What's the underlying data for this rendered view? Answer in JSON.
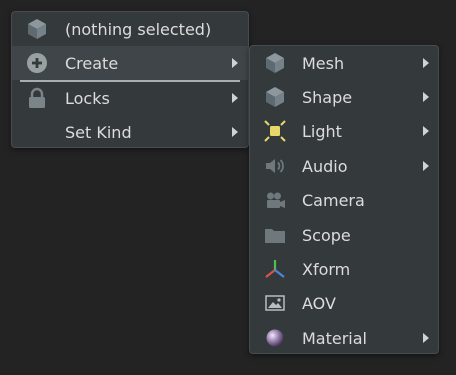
{
  "main_menu": {
    "items": [
      {
        "label": "(nothing selected)",
        "icon": "cube-icon",
        "has_submenu": false
      },
      {
        "label": "Create",
        "icon": "plus-circle-icon",
        "has_submenu": true
      },
      {
        "label": "Locks",
        "icon": "lock-icon",
        "has_submenu": true
      },
      {
        "label": "Set Kind",
        "icon": "",
        "has_submenu": true
      }
    ]
  },
  "create_submenu": {
    "items": [
      {
        "label": "Mesh",
        "icon": "mesh-cube-icon",
        "has_submenu": true
      },
      {
        "label": "Shape",
        "icon": "shape-cube-icon",
        "has_submenu": true
      },
      {
        "label": "Light",
        "icon": "light-icon",
        "has_submenu": true
      },
      {
        "label": "Audio",
        "icon": "speaker-icon",
        "has_submenu": true
      },
      {
        "label": "Camera",
        "icon": "camera-icon",
        "has_submenu": false
      },
      {
        "label": "Scope",
        "icon": "folder-icon",
        "has_submenu": false
      },
      {
        "label": "Xform",
        "icon": "xform-axes-icon",
        "has_submenu": false
      },
      {
        "label": "AOV",
        "icon": "image-icon",
        "has_submenu": false
      },
      {
        "label": "Material",
        "icon": "material-sphere-icon",
        "has_submenu": true
      }
    ]
  },
  "colors": {
    "menu_bg": "#34393c",
    "highlight_bg": "#3f4548",
    "text": "#dcdcdc",
    "light_yellow": "#e6d96a",
    "xform_red": "#e0504a",
    "xform_green": "#4fbf5a",
    "xform_blue": "#4a86e0"
  }
}
